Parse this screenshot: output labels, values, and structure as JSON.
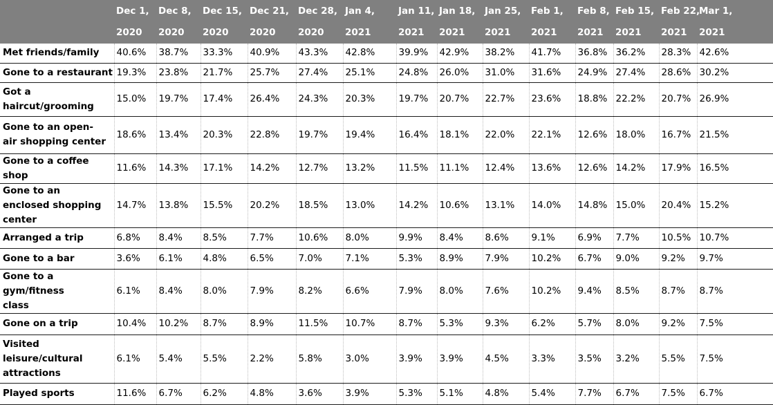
{
  "chart_data": {
    "type": "table",
    "title": "",
    "columns": [
      {
        "line1": "Dec 1,",
        "line2": "2020"
      },
      {
        "line1": "Dec 8,",
        "line2": "2020"
      },
      {
        "line1": "Dec 15,",
        "line2": "2020"
      },
      {
        "line1": "Dec 21,",
        "line2": "2020"
      },
      {
        "line1": "Dec 28,",
        "line2": "2020"
      },
      {
        "line1": "Jan 4,",
        "line2": "2021"
      },
      {
        "line1": "Jan 11,",
        "line2": "2021"
      },
      {
        "line1": "Jan 18,",
        "line2": "2021"
      },
      {
        "line1": "Jan 25,",
        "line2": "2021"
      },
      {
        "line1": "Feb 1,",
        "line2": "2021"
      },
      {
        "line1": "Feb 8,",
        "line2": "2021"
      },
      {
        "line1": "Feb 15,",
        "line2": "2021"
      },
      {
        "line1": "Feb 22,",
        "line2": "2021"
      },
      {
        "line1": "Mar 1,",
        "line2": "2021"
      }
    ],
    "rows": [
      {
        "label": "Met friends/family",
        "values": [
          "40.6%",
          "38.7%",
          "33.3%",
          "40.9%",
          "43.3%",
          "42.8%",
          "39.9%",
          "42.9%",
          "38.2%",
          "41.7%",
          "36.8%",
          "36.2%",
          "28.3%",
          "42.6%"
        ]
      },
      {
        "label": "Gone to a restaurant",
        "values": [
          "19.3%",
          "23.8%",
          "21.7%",
          "25.7%",
          "27.4%",
          "25.1%",
          "24.8%",
          "26.0%",
          "31.0%",
          "31.6%",
          "24.9%",
          "27.4%",
          "28.6%",
          "30.2%"
        ]
      },
      {
        "label": "Got a haircut/grooming",
        "values": [
          "15.0%",
          "19.7%",
          "17.4%",
          "26.4%",
          "24.3%",
          "20.3%",
          "19.7%",
          "20.7%",
          "22.7%",
          "23.6%",
          "18.8%",
          "22.2%",
          "20.7%",
          "26.9%"
        ]
      },
      {
        "label": "Gone to an open-air shopping center",
        "values": [
          "18.6%",
          "13.4%",
          "20.3%",
          "22.8%",
          "19.7%",
          "19.4%",
          "16.4%",
          "18.1%",
          "22.0%",
          "22.1%",
          "12.6%",
          "18.0%",
          "16.7%",
          "21.5%"
        ]
      },
      {
        "label": "Gone to a coffee shop",
        "values": [
          "11.6%",
          "14.3%",
          "17.1%",
          "14.2%",
          "12.7%",
          "13.2%",
          "11.5%",
          "11.1%",
          "12.4%",
          "13.6%",
          "12.6%",
          "14.2%",
          "17.9%",
          "16.5%"
        ]
      },
      {
        "label": "Gone to an enclosed shopping center",
        "values": [
          "14.7%",
          "13.8%",
          "15.5%",
          "20.2%",
          "18.5%",
          "13.0%",
          "14.2%",
          "10.6%",
          "13.1%",
          "14.0%",
          "14.8%",
          "15.0%",
          "20.4%",
          "15.2%"
        ]
      },
      {
        "label": "Arranged a trip",
        "values": [
          "6.8%",
          "8.4%",
          "8.5%",
          "7.7%",
          "10.6%",
          "8.0%",
          "9.9%",
          "8.4%",
          "8.6%",
          "9.1%",
          "6.9%",
          "7.7%",
          "10.5%",
          "10.7%"
        ]
      },
      {
        "label": "Gone to a bar",
        "values": [
          "3.6%",
          "6.1%",
          "4.8%",
          "6.5%",
          "7.0%",
          "7.1%",
          "5.3%",
          "8.9%",
          "7.9%",
          "10.2%",
          "6.7%",
          "9.0%",
          "9.2%",
          "9.7%"
        ]
      },
      {
        "label": "Gone to a gym/fitness class",
        "values": [
          "6.1%",
          "8.4%",
          "8.0%",
          "7.9%",
          "8.2%",
          "6.6%",
          "7.9%",
          "8.0%",
          "7.6%",
          "10.2%",
          "9.4%",
          "8.5%",
          "8.7%",
          "8.7%"
        ]
      },
      {
        "label": "Gone on a trip",
        "values": [
          "10.4%",
          "10.2%",
          "8.7%",
          "8.9%",
          "11.5%",
          "10.7%",
          "8.7%",
          "5.3%",
          "9.3%",
          "6.2%",
          "5.7%",
          "8.0%",
          "9.2%",
          "7.5%"
        ]
      },
      {
        "label": "Visited leisure/cultural attractions",
        "values": [
          "6.1%",
          "5.4%",
          "5.5%",
          "2.2%",
          "5.8%",
          "3.0%",
          "3.9%",
          "3.9%",
          "4.5%",
          "3.3%",
          "3.5%",
          "3.2%",
          "5.5%",
          "7.5%"
        ]
      },
      {
        "label": "Played sports",
        "values": [
          "11.6%",
          "6.7%",
          "6.2%",
          "4.8%",
          "3.6%",
          "3.9%",
          "5.3%",
          "5.1%",
          "4.8%",
          "5.4%",
          "7.7%",
          "6.7%",
          "7.5%",
          "6.7%"
        ]
      }
    ]
  },
  "colors": {
    "header_bg": "#808080",
    "header_text": "#ffffff",
    "row_divider": "#1a1a1a"
  }
}
